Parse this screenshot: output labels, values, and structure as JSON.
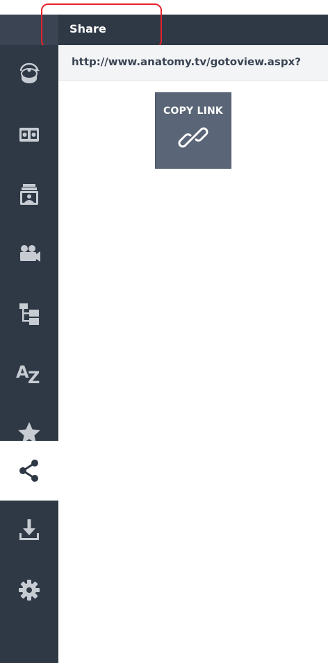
{
  "header": {
    "title": "Share"
  },
  "share": {
    "url": "http://www.anatomy.tv/gotoview.aspx?",
    "copy_link_label": "COPY LINK"
  },
  "sidebar": {
    "items": [
      {
        "icon": "rotate-3d-icon",
        "active": false
      },
      {
        "icon": "layers-icon",
        "active": false
      },
      {
        "icon": "slides-icon",
        "active": false
      },
      {
        "icon": "video-camera-icon",
        "active": false
      },
      {
        "icon": "hierarchy-tree-icon",
        "active": false
      },
      {
        "icon": "a-z-index-icon",
        "label": "AZ",
        "active": false
      },
      {
        "icon": "star-icon",
        "active": false
      },
      {
        "icon": "share-icon",
        "active": true
      },
      {
        "icon": "download-icon",
        "active": false
      },
      {
        "icon": "gear-icon",
        "active": false
      }
    ]
  },
  "colors": {
    "sidebar_bg": "#2f3845",
    "icon": "#c7ccd3",
    "active_icon": "#2f3845",
    "copy_button_bg": "#5a6677",
    "highlight": "#e8232a"
  }
}
